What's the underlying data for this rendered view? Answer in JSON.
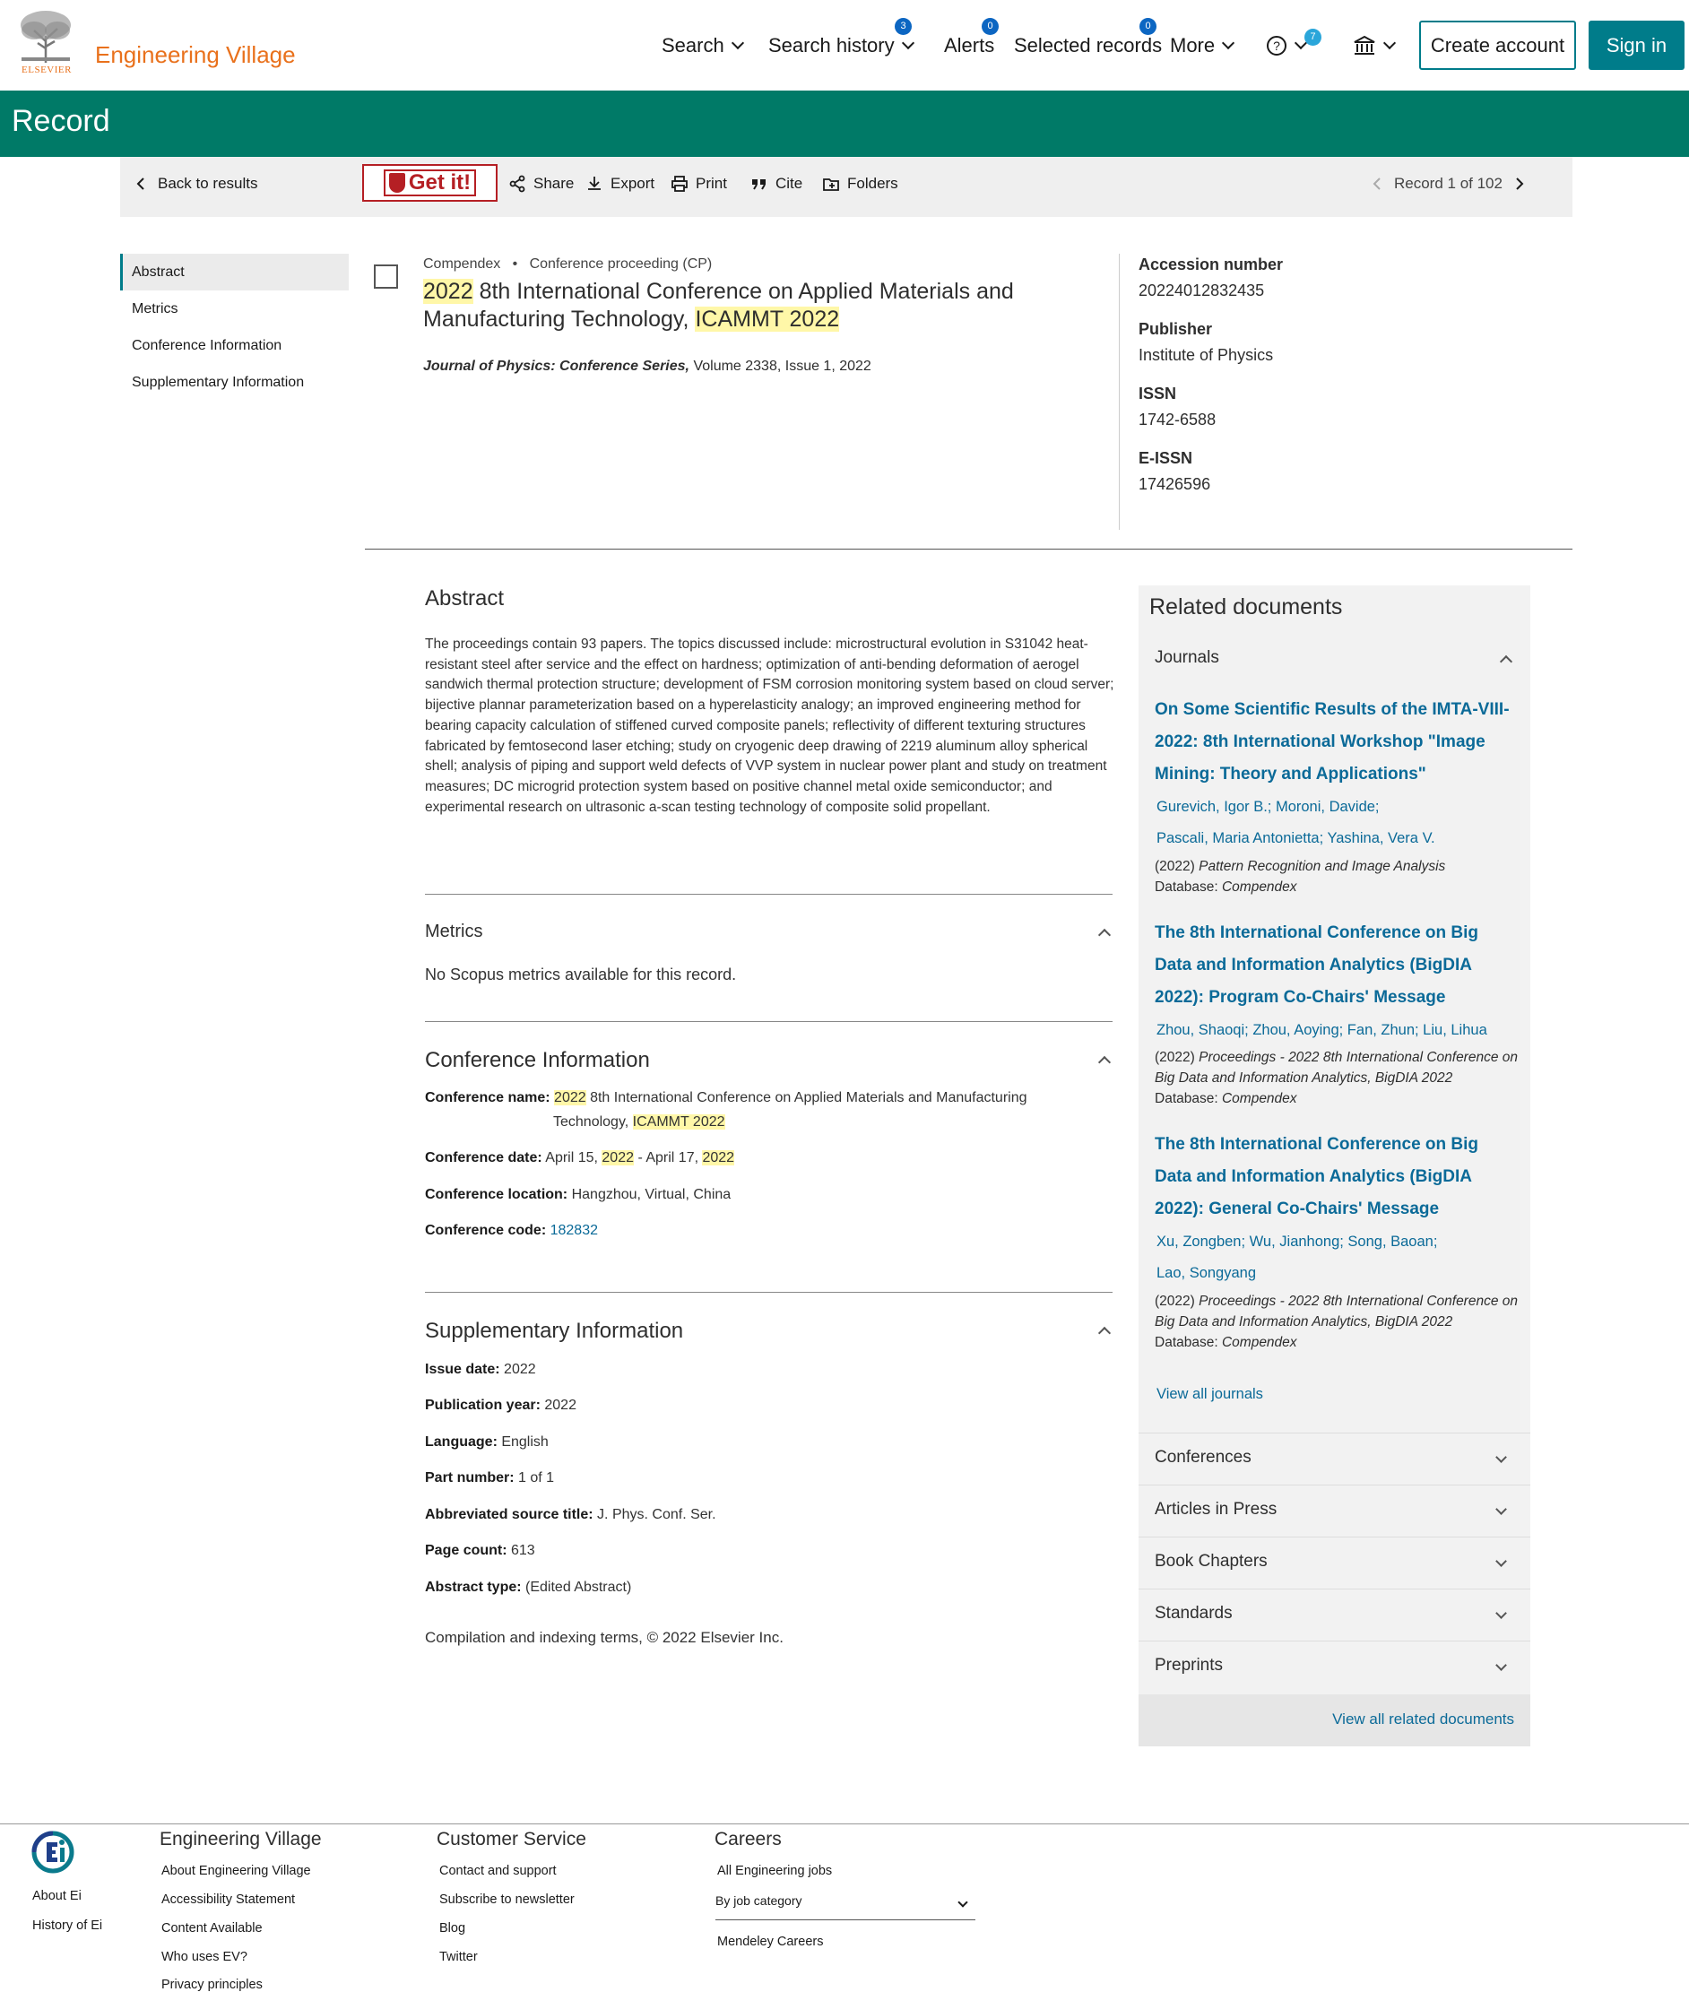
{
  "header": {
    "brand_small": "ELSEVIER",
    "brand": "Engineering Village",
    "nav": [
      {
        "label": "Search",
        "badge": ""
      },
      {
        "label": "Search history",
        "badge": "3"
      },
      {
        "label": "Alerts",
        "badge": "0"
      },
      {
        "label": "Selected records",
        "badge": "0"
      },
      {
        "label": "More",
        "badge": ""
      }
    ],
    "help_badge": "7",
    "create_account": "Create account",
    "sign_in": "Sign in"
  },
  "banner": {
    "title": "Record"
  },
  "toolbar": {
    "back": "Back to results",
    "getit": "Get it!",
    "share": "Share",
    "export": "Export",
    "print": "Print",
    "cite": "Cite",
    "folders": "Folders",
    "record_counter": "Record 1 of 102"
  },
  "section_nav": [
    "Abstract",
    "Metrics",
    "Conference Information",
    "Supplementary Information"
  ],
  "record": {
    "database": "Compendex",
    "doc_type": "Conference proceeding (CP)",
    "title_year": "2022",
    "title_mid": " 8th International Conference on Applied Materials and Manufacturing Technology, ",
    "title_acronym": "ICAMMT 2022",
    "source_journal": "Journal of Physics: Conference Series,",
    "source_rest": " Volume 2338, Issue 1, 2022"
  },
  "meta": {
    "accession_label": "Accession number",
    "accession_value": "20224012832435",
    "publisher_label": "Publisher",
    "publisher_value": "Institute of Physics",
    "issn_label": "ISSN",
    "issn_value": "1742-6588",
    "eissn_label": "E-ISSN",
    "eissn_value": "17426596"
  },
  "abstract": {
    "heading": "Abstract",
    "text": "The proceedings contain 93 papers. The topics discussed include: microstructural evolution in S31042 heat-resistant steel after service and the effect on hardness; optimization of anti-bending deformation of aerogel sandwich thermal protection structure; development of FSM corrosion monitoring system based on cloud server; bijective plannar parameterization based on a hyperelasticity analogy; an improved engineering method for bearing capacity calculation of stiffened curved composite panels; reflectivity of different texturing structures fabricated by femtosecond laser etching; study on cryogenic deep drawing of 2219 aluminum alloy spherical shell; analysis of piping and support weld defects of VVP system in nuclear power plant and study on treatment measures; DC microgrid protection system based on positive channel metal oxide semiconductor; and experimental research on ultrasonic a-scan testing technology of composite solid propellant."
  },
  "metrics": {
    "heading": "Metrics",
    "text": "No Scopus metrics available for this record."
  },
  "conference": {
    "heading": "Conference Information",
    "name_label": "Conference name:",
    "name_year": "2022",
    "name_mid": " 8th International Conference on Applied Materials and Manufacturing",
    "name_line2": "Technology, ",
    "name_acronym": "ICAMMT 2022",
    "date_label": "Conference date:",
    "date_a": " April 15, ",
    "date_y1": "2022",
    "date_b": " - April 17, ",
    "date_y2": "2022",
    "location_label": "Conference location:",
    "location_value": " Hangzhou, Virtual, China",
    "code_label": "Conference code:",
    "code_value": "182832"
  },
  "supplementary": {
    "heading": "Supplementary Information",
    "rows": [
      {
        "label": "Issue date:",
        "value": " 2022"
      },
      {
        "label": "Publication year:",
        "value": " 2022"
      },
      {
        "label": "Language:",
        "value": " English"
      },
      {
        "label": "Part number:",
        "value": " 1 of 1"
      },
      {
        "label": "Abbreviated source title:",
        "value": " J. Phys. Conf. Ser."
      },
      {
        "label": "Page count:",
        "value": " 613"
      },
      {
        "label": "Abstract type:",
        "value": " (Edited Abstract)"
      }
    ],
    "copyright": "Compilation and indexing terms, © 2022 Elsevier Inc."
  },
  "related": {
    "heading": "Related documents",
    "journals_label": "Journals",
    "docs": [
      {
        "title": "On Some Scientific Results of the IMTA-VIII-2022: 8th International Workshop \"Image Mining: Theory and Applications\"",
        "authors1": "Gurevich, Igor B.; Moroni, Davide;",
        "authors2": "Pascali, Maria Antonietta; Yashina, Vera V.",
        "year": "(2022) ",
        "source": "Pattern Recognition and Image Analysis",
        "db_label": "Database: ",
        "db": "Compendex"
      },
      {
        "title": "The 8th International Conference on Big Data and Information Analytics (BigDIA 2022): Program Co-Chairs' Message",
        "authors1": "Zhou, Shaoqi; Zhou, Aoying; Fan, Zhun; Liu, Lihua",
        "authors2": "",
        "year": "(2022) ",
        "source": "Proceedings - 2022 8th International Conference on Big Data and Information Analytics, BigDIA 2022",
        "db_label": "Database: ",
        "db": "Compendex"
      },
      {
        "title": "The 8th International Conference on Big Data and Information Analytics (BigDIA 2022): General Co-Chairs' Message",
        "authors1": "Xu, Zongben; Wu, Jianhong; Song, Baoan;",
        "authors2": "Lao, Songyang",
        "year": "(2022) ",
        "source": "Proceedings - 2022 8th International Conference on Big Data and Information Analytics, BigDIA 2022",
        "db_label": "Database: ",
        "db": "Compendex"
      }
    ],
    "view_all_journals": "View all journals",
    "categories": [
      "Conferences",
      "Articles in Press",
      "Book Chapters",
      "Standards",
      "Preprints"
    ],
    "view_all_related": "View all related documents"
  },
  "footer": {
    "about_ei": "About Ei",
    "history_ei": "History of Ei",
    "col1_head": "Engineering Village",
    "col1": [
      "About Engineering Village",
      "Accessibility Statement",
      "Content Available",
      "Who uses EV?",
      "Privacy principles"
    ],
    "col2_head": "Customer Service",
    "col2": [
      "Contact and support",
      "Subscribe to newsletter",
      "Blog",
      "Twitter"
    ],
    "col3_head": "Careers",
    "col3_link": "All Engineering jobs",
    "job_select": "By job category",
    "col3_link2": "Mendeley Careers"
  }
}
